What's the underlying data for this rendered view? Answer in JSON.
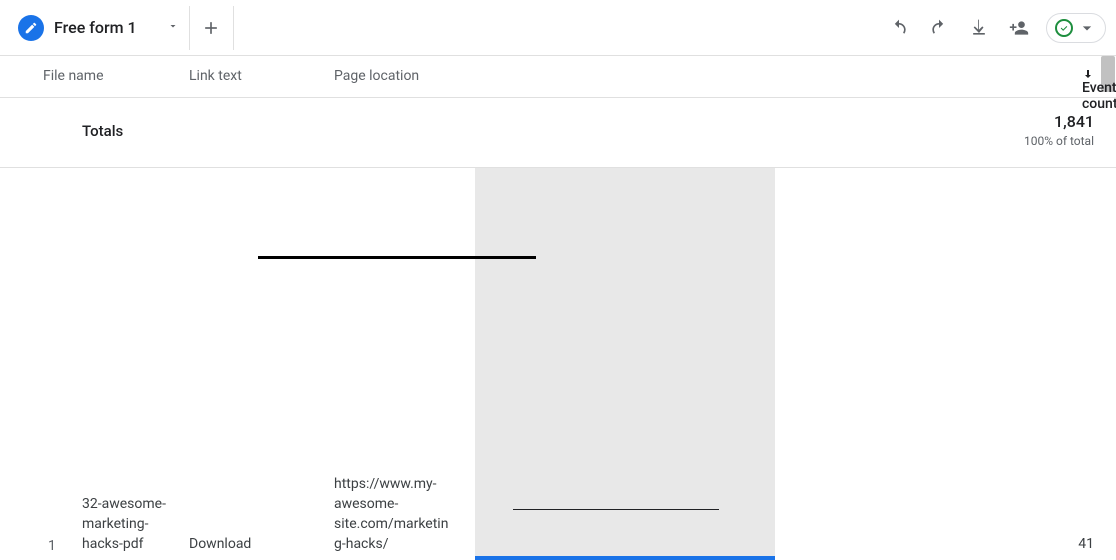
{
  "tab": {
    "title": "Free form 1"
  },
  "columns": {
    "filename": "File name",
    "linktext": "Link text",
    "pagelocation": "Page location",
    "eventcount": "Event count"
  },
  "totals": {
    "label": "Totals",
    "value": "1,841",
    "subtext": "100% of total"
  },
  "rows": [
    {
      "num": "1",
      "filename": "32-awesome-marketing-hacks-pdf",
      "linktext": "Download",
      "pagelocation": "https://www.my-awesome-site.com/marketing-hacks/",
      "value": "41"
    }
  ]
}
